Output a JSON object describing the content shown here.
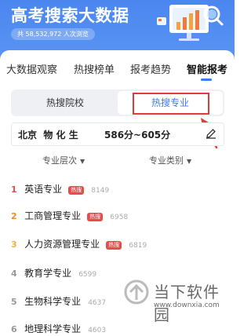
{
  "header": {
    "title": "高考搜索大数据",
    "views": "共 58,532,972 人次浏览"
  },
  "tabs": [
    "大数据观察",
    "热搜榜单",
    "报考趋势",
    "智能报考"
  ],
  "segment": {
    "left": "热搜院校",
    "right": "热搜专业"
  },
  "condition": {
    "text": "北京  物 化 生",
    "score": "586分~605分"
  },
  "filters": {
    "level": "专业层次",
    "category": "专业类别"
  },
  "hot_label": "热搜",
  "list": [
    {
      "rank": "1",
      "name": "英语专业",
      "hot": true,
      "count": "8149"
    },
    {
      "rank": "2",
      "name": "工商管理专业",
      "hot": true,
      "count": "6958"
    },
    {
      "rank": "3",
      "name": "人力资源管理专业",
      "hot": true,
      "count": "6819"
    },
    {
      "rank": "4",
      "name": "教育学专业",
      "hot": false,
      "count": "6599"
    },
    {
      "rank": "5",
      "name": "生物科学专业",
      "hot": false,
      "count": "4637"
    },
    {
      "rank": "6",
      "name": "地理科学专业",
      "hot": false,
      "count": "4603"
    }
  ],
  "watermark": {
    "cn": "当下软件园",
    "en": "www.downxia.com"
  }
}
